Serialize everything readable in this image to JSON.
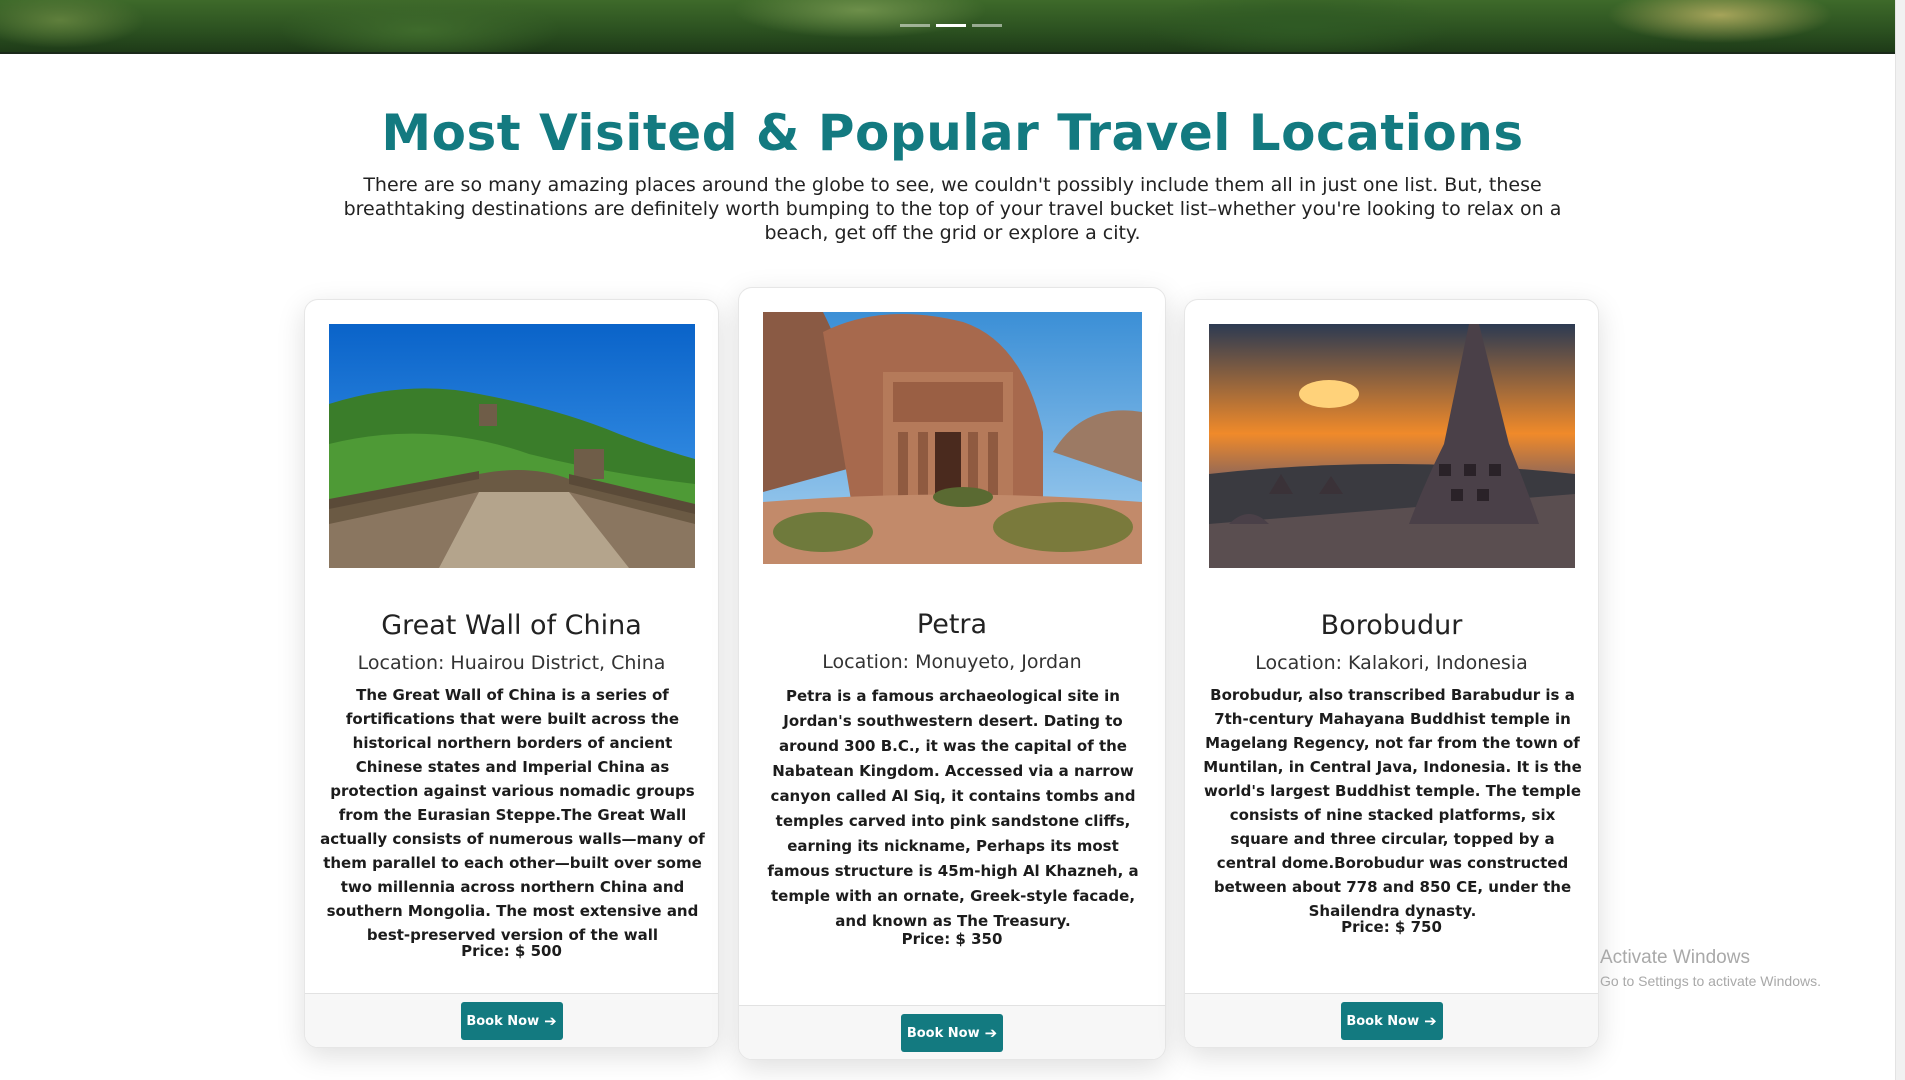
{
  "section": {
    "title": "Most Visited & Popular Travel Locations",
    "intro": "There are so many amazing places around the globe to see, we couldn't possibly include them all in just one list. But, these breathtaking destinations are definitely worth bumping to the top of your travel bucket list–whether you're looking to relax on a beach, get off the grid or explore a city."
  },
  "hero": {
    "slides": 3,
    "active_slide": 2
  },
  "cards": [
    {
      "title": "Great Wall of China",
      "location": "Location: Huairou District, China",
      "description": "The Great Wall of China is a series of fortifications that were built across the historical northern borders of ancient Chinese states and Imperial China as protection against various nomadic groups from the Eurasian Steppe.The Great Wall actually consists of numerous walls—many of them parallel to each other—built over some two millennia across northern China and southern Mongolia. The most extensive and best-preserved version of the wall",
      "price": "Price: $ 500",
      "button": "Book Now"
    },
    {
      "title": "Petra",
      "location": "Location: Monuyeto, Jordan",
      "description": "Petra is a famous archaeological site in Jordan's southwestern desert. Dating to around 300 B.C., it was the capital of the Nabatean Kingdom. Accessed via a narrow canyon called Al Siq, it contains tombs and temples carved into pink sandstone cliffs, earning its nickname, Perhaps its most famous structure is 45m-high Al Khazneh, a temple with an ornate, Greek-style facade, and known as The Treasury.",
      "price": "Price: $ 350",
      "button": "Book Now"
    },
    {
      "title": "Borobudur",
      "location": "Location: Kalakori, Indonesia",
      "description": "Borobudur, also transcribed Barabudur is a 7th-century Mahayana Buddhist temple in Magelang Regency, not far from the town of Muntilan, in Central Java, Indonesia. It is the world's largest Buddhist temple. The temple consists of nine stacked platforms, six square and three circular, topped by a central dome.Borobudur was constructed between about 778 and 850 CE, under the Shailendra dynasty.",
      "price": "Price: $ 750",
      "button": "Book Now"
    }
  ],
  "watermark": {
    "title": "Activate Windows",
    "subtitle": "Go to Settings to activate Windows."
  },
  "colors": {
    "accent": "#137a80",
    "text": "#222222"
  }
}
